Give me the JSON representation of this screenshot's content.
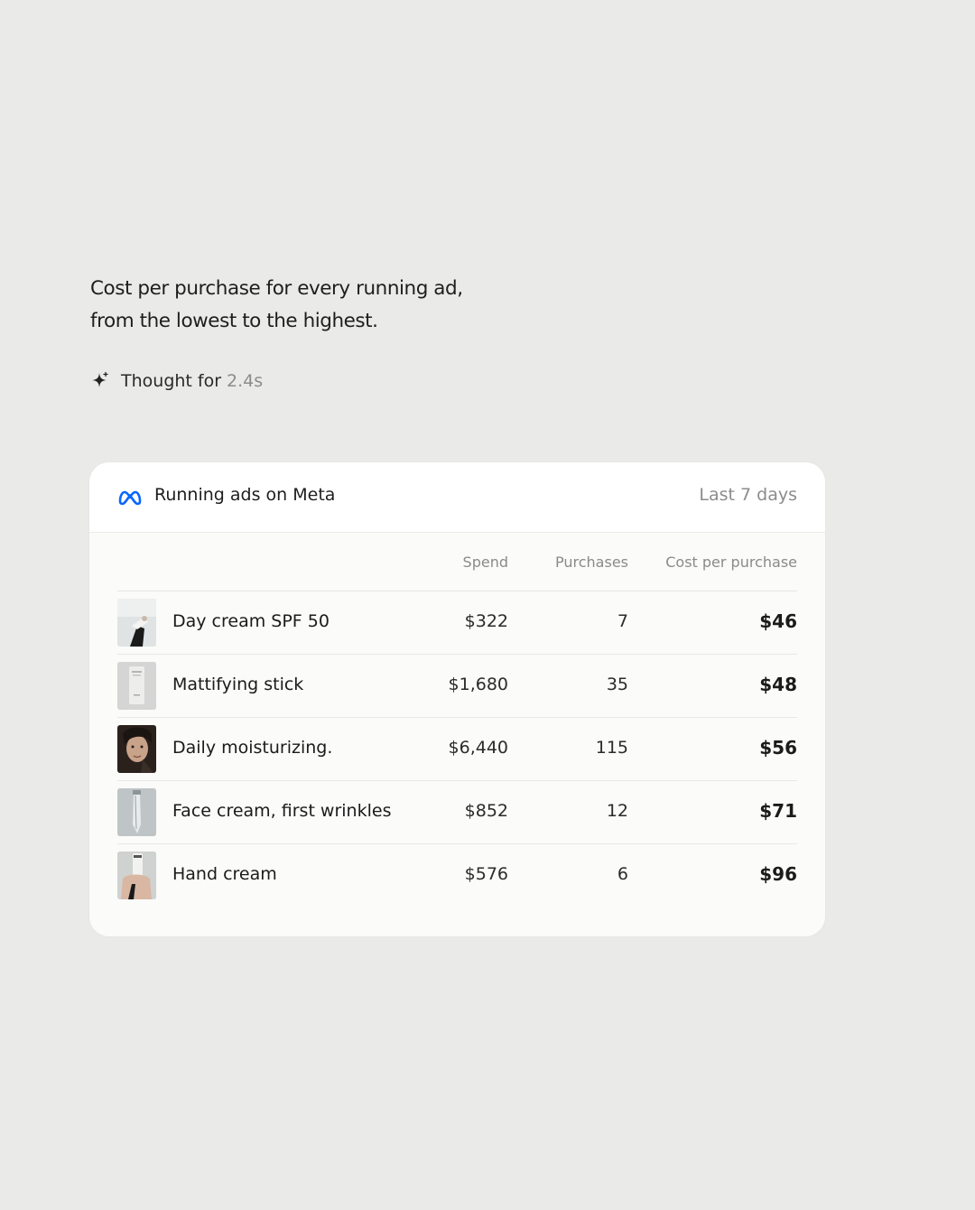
{
  "prompt": {
    "line1": "Cost per purchase for every running ad,",
    "line2": "from the lowest to the highest."
  },
  "thought": {
    "label": "Thought for",
    "duration": "2.4s",
    "icon": "sparkle-icon"
  },
  "card": {
    "icon": "meta-logo-icon",
    "title": "Running ads on Meta",
    "period": "Last 7 days",
    "columns": {
      "spend": "Spend",
      "purchases": "Purchases",
      "cost_per_purchase": "Cost per purchase"
    },
    "rows": [
      {
        "name": "Day cream SPF 50",
        "spend": "$322",
        "purchases": "7",
        "cost_per_purchase": "$46"
      },
      {
        "name": "Mattifying stick",
        "spend": "$1,680",
        "purchases": "35",
        "cost_per_purchase": "$48"
      },
      {
        "name": "Daily moisturizing.",
        "spend": "$6,440",
        "purchases": "115",
        "cost_per_purchase": "$56"
      },
      {
        "name": "Face cream, first wrinkles",
        "spend": "$852",
        "purchases": "12",
        "cost_per_purchase": "$71"
      },
      {
        "name": "Hand cream",
        "spend": "$576",
        "purchases": "6",
        "cost_per_purchase": "$96"
      }
    ]
  },
  "colors": {
    "background": "#eaeae8",
    "card": "#fbfbf9",
    "meta_blue": "#0866ff",
    "muted_text": "#8c8c8c"
  }
}
